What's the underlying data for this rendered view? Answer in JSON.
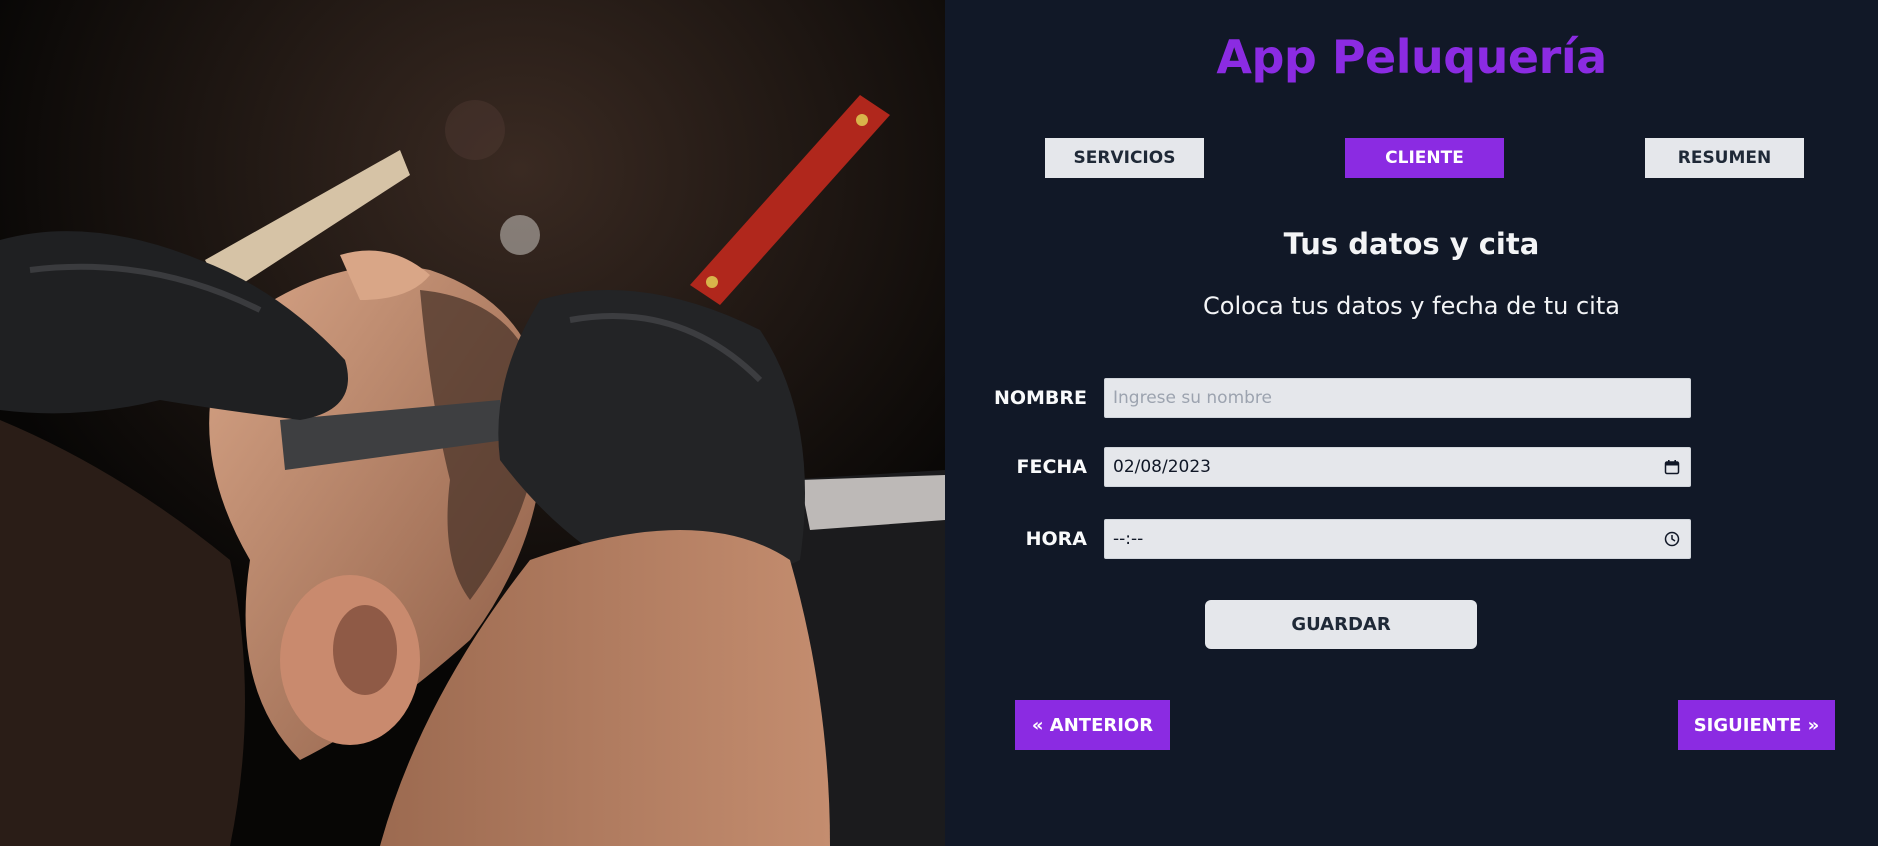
{
  "app": {
    "title": "App Peluquería"
  },
  "tabs": [
    {
      "label": "SERVICIOS",
      "active": false
    },
    {
      "label": "CLIENTE",
      "active": true
    },
    {
      "label": "RESUMEN",
      "active": false
    }
  ],
  "section": {
    "title": "Tus datos y cita",
    "subtitle": "Coloca tus datos y fecha de tu cita"
  },
  "form": {
    "name": {
      "label": "NOMBRE",
      "placeholder": "Ingrese su nombre",
      "value": ""
    },
    "date": {
      "label": "FECHA",
      "value": "02/08/2023",
      "icon": "calendar-icon"
    },
    "time": {
      "label": "HORA",
      "value": "--:--",
      "icon": "clock-icon"
    },
    "save_label": "GUARDAR"
  },
  "navigation": {
    "prev_label": "« ANTERIOR",
    "next_label": "SIGUIENTE »"
  },
  "colors": {
    "accent": "#8b2be2",
    "background": "#111827",
    "button_light": "#e5e7eb"
  }
}
